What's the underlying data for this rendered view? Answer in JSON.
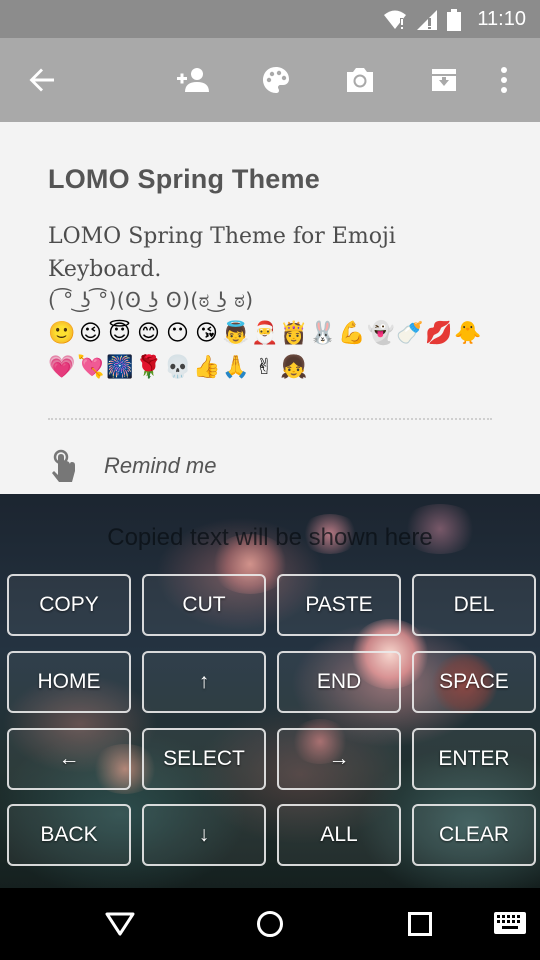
{
  "status_bar": {
    "time": "11:10",
    "icons": [
      "wifi-icon",
      "signal-icon",
      "battery-icon"
    ]
  },
  "toolbar": {
    "buttons": [
      "back-arrow-icon",
      "add-person-icon",
      "palette-icon",
      "camera-icon",
      "archive-icon",
      "more-vert-icon"
    ]
  },
  "note": {
    "title": "LOMO Spring Theme",
    "body": "LOMO Spring Theme for Emoji Keyboard.",
    "kaomoji": "( ͡° ͜ʖ ͡°)(ʘ ͜ʖ ʘ)(ಠ ͜ʖ ಠ)",
    "emoji_row_1": [
      "🙂",
      "😉",
      "😇",
      "😊",
      "😶",
      "😘",
      "👼",
      "🎅",
      "👸",
      "🐰",
      "💪",
      "👻",
      "🍼",
      "💋",
      "🐥"
    ],
    "emoji_row_2": [
      "💗",
      "💘",
      "🎆",
      "🌹",
      "💀",
      "👍",
      "🙏",
      "✌",
      "👧"
    ],
    "remind_label": "Remind me"
  },
  "keyboard": {
    "clipboard_placeholder": "Copied text will be shown here",
    "keys": {
      "copy": "COPY",
      "cut": "CUT",
      "paste": "PASTE",
      "del": "DEL",
      "home": "HOME",
      "up": "↑",
      "end": "END",
      "space": "SPACE",
      "left": "←",
      "select": "SELECT",
      "right": "→",
      "enter": "ENTER",
      "back": "BACK",
      "down": "↓",
      "all": "ALL",
      "clear": "CLEAR"
    }
  },
  "navbar": {
    "buttons": [
      "back-triangle-icon",
      "home-circle-icon",
      "recents-square-icon",
      "keyboard-icon"
    ]
  },
  "colors": {
    "status_bar": "#8c8c8c",
    "toolbar": "#a9a9a9",
    "content_bg": "#f3f3f3",
    "key_border": "#ebebeb"
  }
}
